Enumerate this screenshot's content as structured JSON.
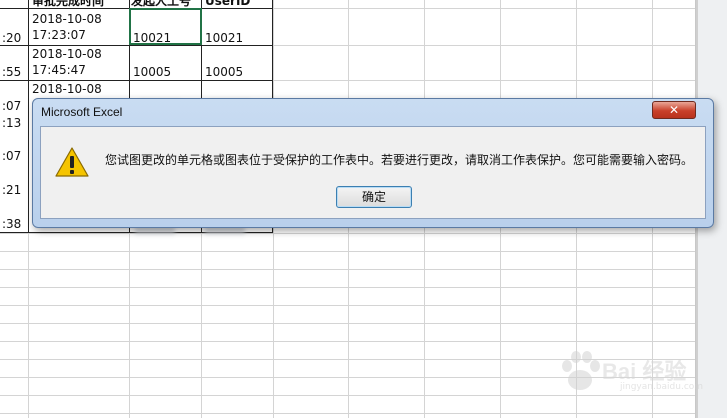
{
  "sheet": {
    "header_row": [
      "审批完成时间",
      "发起人工号",
      "UserID"
    ],
    "rows": [
      {
        "time_prefix": ":20",
        "date": "2018-10-08",
        "time": "17:23:07",
        "initiator_id": "10021",
        "user_id": "10021"
      },
      {
        "time_prefix": ":55",
        "date": "2018-10-08",
        "time": "17:45:47",
        "initiator_id": "10005",
        "user_id": "10005"
      },
      {
        "time_prefix": ":07",
        "date": "2018-10-08",
        "time": "",
        "initiator_id": "",
        "user_id": ""
      }
    ],
    "partial_prefixes": [
      ":13",
      ":07",
      ":21",
      ":38"
    ]
  },
  "dialog": {
    "title": "Microsoft Excel",
    "close_label": "✕",
    "icon": "warning-icon",
    "message": "您试图更改的单元格或图表位于受保护的工作表中。若要进行更改，请取消工作表保护。您可能需要输入密码。",
    "ok_label": "确定"
  },
  "watermark": {
    "text": "Bai 经验",
    "sub": "jingyan.baidu.com"
  },
  "colors": {
    "selection": "#217346",
    "dialog_frame": "#b9d0ec",
    "close_button": "#c9402a",
    "warning": "#f5c400"
  }
}
